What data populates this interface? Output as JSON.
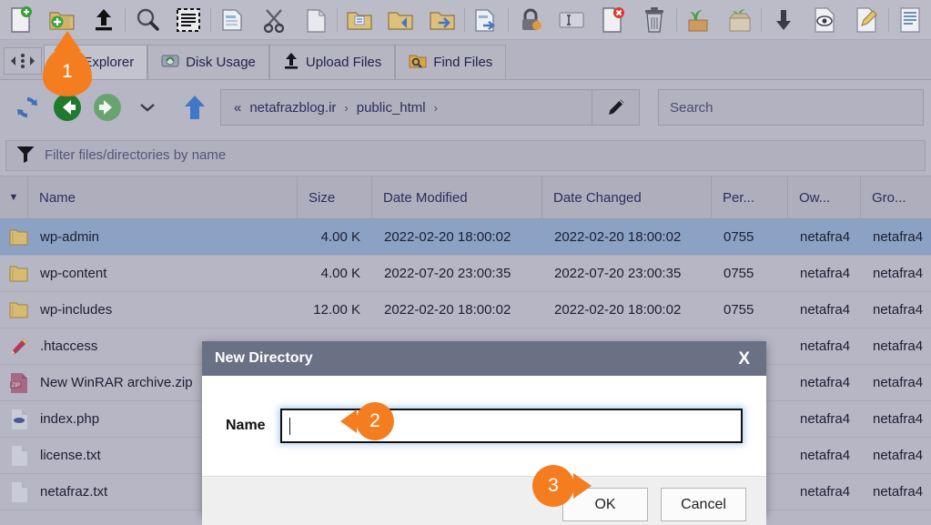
{
  "colors": {
    "accent_orange": "#f47d20",
    "page_bg": "#b6b6c4",
    "toolbar_bg": "#bcbcc8",
    "row_selected": "#8ba2c4",
    "dialog_title_bg": "#6b7185",
    "text": "#1d1d33",
    "header_text": "#2d2d5e"
  },
  "toolbar": {
    "buttons": [
      {
        "name": "new-file-icon",
        "title": "New File"
      },
      {
        "name": "new-folder-icon",
        "title": "New Folder"
      },
      {
        "name": "upload-icon",
        "title": "Upload"
      },
      {
        "name": "search-icon",
        "title": "Search"
      },
      {
        "name": "select-all-icon",
        "title": "Select All"
      },
      {
        "name": "copy-icon",
        "title": "Copy"
      },
      {
        "name": "cut-icon",
        "title": "Cut"
      },
      {
        "name": "paste-icon",
        "title": "Paste"
      },
      {
        "name": "move-file-icon",
        "title": "Move"
      },
      {
        "name": "folder-down-icon",
        "title": "Download to Folder"
      },
      {
        "name": "folder-in-icon",
        "title": "Move Into"
      },
      {
        "name": "copy-file-icon",
        "title": "Copy File"
      },
      {
        "name": "permissions-lock-icon",
        "title": "Permissions"
      },
      {
        "name": "rename-icon",
        "title": "Rename"
      },
      {
        "name": "delete-file-icon",
        "title": "Delete File"
      },
      {
        "name": "trash-icon",
        "title": "Trash"
      },
      {
        "name": "extract-icon",
        "title": "Extract"
      },
      {
        "name": "compress-icon",
        "title": "Compress"
      },
      {
        "name": "download-icon",
        "title": "Download"
      },
      {
        "name": "view-icon",
        "title": "View"
      },
      {
        "name": "edit-icon",
        "title": "Edit"
      },
      {
        "name": "code-edit-icon",
        "title": "HTML Editor"
      }
    ]
  },
  "tabs": [
    {
      "label": "File Explorer",
      "icon": "folder-icon",
      "active": true
    },
    {
      "label": "Disk Usage",
      "icon": "disk-icon",
      "active": false
    },
    {
      "label": "Upload Files",
      "icon": "upload-icon",
      "active": false
    },
    {
      "label": "Find Files",
      "icon": "find-icon",
      "active": false
    }
  ],
  "nav": {
    "reload_icon": "reload-icon",
    "back_icon": "back-arrow-icon",
    "forward_icon": "forward-arrow-icon",
    "history_icon": "chevron-down-icon",
    "up_icon": "up-arrow-icon",
    "breadcrumb_prefix": "«",
    "breadcrumbs": [
      "netafrazblog.ir",
      "public_html"
    ],
    "breadcrumb_separator": "›",
    "breadcrumb_trailing": "›",
    "edit_path_icon": "pencil-icon",
    "search_placeholder": "Search",
    "search_value": ""
  },
  "filter": {
    "icon": "funnel-icon",
    "placeholder": "Filter files/directories by name",
    "value": ""
  },
  "table": {
    "sort_caret": "▼",
    "columns": [
      {
        "key": "name",
        "label": "Name"
      },
      {
        "key": "size",
        "label": "Size"
      },
      {
        "key": "modified",
        "label": "Date Modified"
      },
      {
        "key": "changed",
        "label": "Date Changed"
      },
      {
        "key": "perms",
        "label": "Per..."
      },
      {
        "key": "owner",
        "label": "Ow..."
      },
      {
        "key": "group",
        "label": "Gro..."
      }
    ],
    "rows": [
      {
        "icon": "folder-icon",
        "name": "wp-admin",
        "size": "4.00 K",
        "modified": "2022-02-20 18:00:02",
        "changed": "2022-02-20 18:00:02",
        "perms": "0755",
        "owner": "netafra4",
        "group": "netafra4",
        "selected": true
      },
      {
        "icon": "folder-icon",
        "name": "wp-content",
        "size": "4.00 K",
        "modified": "2022-07-20 23:00:35",
        "changed": "2022-07-20 23:00:35",
        "perms": "0755",
        "owner": "netafra4",
        "group": "netafra4",
        "selected": false
      },
      {
        "icon": "folder-icon",
        "name": "wp-includes",
        "size": "12.00 K",
        "modified": "2022-02-20 18:00:02",
        "changed": "2022-02-20 18:00:02",
        "perms": "0755",
        "owner": "netafra4",
        "group": "netafra4",
        "selected": false
      },
      {
        "icon": "htaccess-icon",
        "name": ".htaccess",
        "size": "",
        "modified": "",
        "changed": "",
        "perms": "",
        "owner": "netafra4",
        "group": "netafra4",
        "selected": false
      },
      {
        "icon": "zip-icon",
        "name": "New WinRAR archive.zip",
        "size": "",
        "modified": "",
        "changed": "",
        "perms": "",
        "owner": "netafra4",
        "group": "netafra4",
        "selected": false
      },
      {
        "icon": "php-icon",
        "name": "index.php",
        "size": "",
        "modified": "",
        "changed": "",
        "perms": "",
        "owner": "netafra4",
        "group": "netafra4",
        "selected": false
      },
      {
        "icon": "text-icon",
        "name": "license.txt",
        "size": "",
        "modified": "",
        "changed": "",
        "perms": "",
        "owner": "netafra4",
        "group": "netafra4",
        "selected": false
      },
      {
        "icon": "text-icon",
        "name": "netafraz.txt",
        "size": "",
        "modified": "",
        "changed": "",
        "perms": "",
        "owner": "netafra4",
        "group": "netafra4",
        "selected": false
      }
    ]
  },
  "dialog": {
    "title": "New Directory",
    "close_label": "X",
    "name_label": "Name",
    "name_value": "",
    "ok_label": "OK",
    "cancel_label": "Cancel"
  },
  "badges": [
    {
      "number": "1",
      "target": "file-explorer-tab"
    },
    {
      "number": "2",
      "target": "directory-name-input"
    },
    {
      "number": "3",
      "target": "ok-button"
    }
  ]
}
